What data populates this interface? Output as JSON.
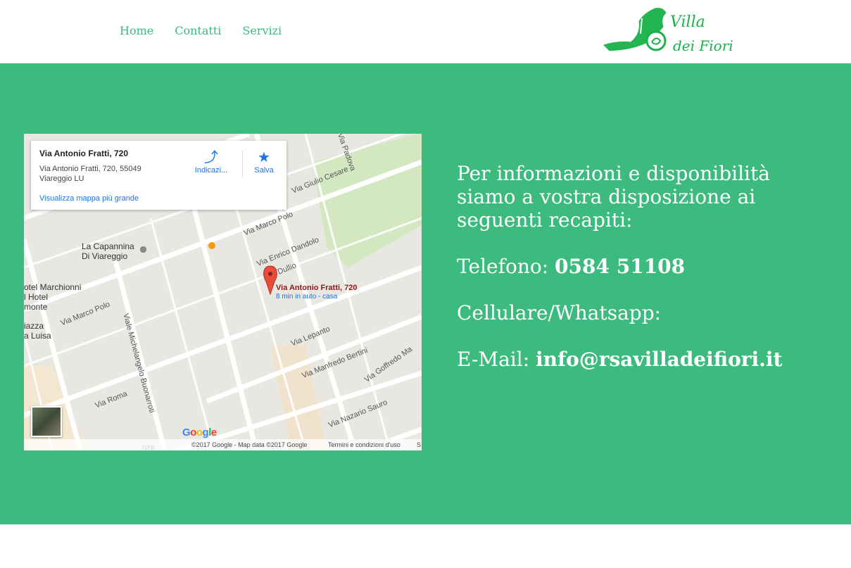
{
  "nav": {
    "items": [
      "Home",
      "Contatti",
      "Servizi"
    ]
  },
  "logo": {
    "line1": "Villa",
    "line2": "dei Fiori"
  },
  "map": {
    "title": "Via Antonio Fratti, 720",
    "address_line1": "Via Antonio Fratti, 720, 55049",
    "address_line2": "Viareggio LU",
    "larger_map_link": "Visualizza mappa più grande",
    "directions_label": "Indicazi...",
    "save_label": "Salva",
    "pin_label": "Via Antonio Fratti, 720",
    "pin_sublabel": "8 min in auto - casa",
    "streets": [
      "Via Padova",
      "Via Giulio Cesare",
      "Via Marco Polo",
      "Via Enrico Dandolo",
      "Dullio",
      "Via Marco Polo",
      "Viale Michelangelo Buonarroti",
      "Via Lepanto",
      "Via Manfredo Bertini",
      "Via Goffredo Ma",
      "Via Roma",
      "Via Nazario Sauro",
      "nze"
    ],
    "poi1": [
      "La Capannina",
      "Di Viareggio"
    ],
    "poi2": [
      "otel Marchionni",
      "l Hotel",
      "monte"
    ],
    "poi3": [
      "iazza",
      "a Luisa"
    ],
    "google_letters": [
      "G",
      "o",
      "o",
      "g",
      "l",
      "e"
    ],
    "copyright": "©2017 Google - Map data ©2017 Google",
    "terms": "Termini e condizioni d'uso",
    "report": "S"
  },
  "contact": {
    "intro": "Per informazioni e disponibilità siamo a vostra disposizione ai seguenti recapiti:",
    "phone_label": "Telefono: ",
    "phone_value": "0584 51108",
    "mobile_label": "Cellulare/Whatsapp:",
    "email_label": "E-Mail: ",
    "email_value": "info@rsavilladeifiori.it"
  },
  "colors": {
    "accent": "#3dbb7e",
    "nav_text": "#3dba7c",
    "logo_green": "#19b24a"
  }
}
